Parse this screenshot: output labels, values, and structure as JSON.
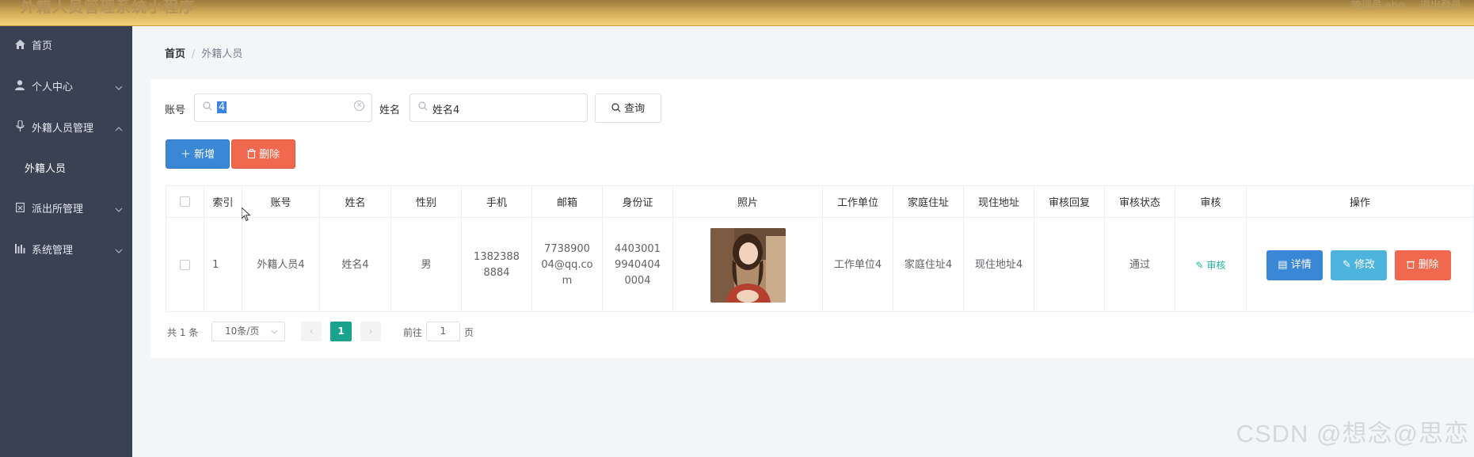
{
  "app": {
    "title": "外籍人员管理系统小程序",
    "admin_label": "管理员 abo",
    "logout_label": "退出登录"
  },
  "sidebar": {
    "items": [
      {
        "label": "首页",
        "icon": "home-icon",
        "has_children": false
      },
      {
        "label": "个人中心",
        "icon": "user-icon",
        "has_children": true
      },
      {
        "label": "外籍人员管理",
        "icon": "mic-icon",
        "has_children": true
      },
      {
        "label": "派出所管理",
        "icon": "clipboard-icon",
        "has_children": true
      },
      {
        "label": "系统管理",
        "icon": "chart-icon",
        "has_children": true
      }
    ],
    "active_sub_item": "外籍人员"
  },
  "breadcrumb": {
    "home": "首页",
    "separator": "/",
    "current": "外籍人员"
  },
  "search": {
    "account_label": "账号",
    "account_value": "4",
    "name_label": "姓名",
    "name_value": "姓名4",
    "query_button": "查询"
  },
  "actions": {
    "add": "新增",
    "delete": "删除"
  },
  "table": {
    "columns": [
      "索引",
      "账号",
      "姓名",
      "性别",
      "手机",
      "邮箱",
      "身份证",
      "照片",
      "工作单位",
      "家庭住址",
      "现住地址",
      "审核回复",
      "审核状态",
      "审核",
      "操作"
    ],
    "rows": [
      {
        "index": "1",
        "account": "外籍人员4",
        "name": "姓名4",
        "gender": "男",
        "phone": "13823888884",
        "email": "773890004@qq.com",
        "id_card": "440300199404040004",
        "work_unit": "工作单位4",
        "home_address": "家庭住址4",
        "current_address": "现住地址4",
        "audit_reply": "",
        "audit_status": "通过",
        "audit_action": "审核",
        "ops": {
          "detail": "详情",
          "edit": "修改",
          "delete": "删除"
        }
      }
    ]
  },
  "pagination": {
    "total_text": "共 1 条",
    "page_size": "10条/页",
    "current_page": "1",
    "goto_label": "前往",
    "goto_value": "1",
    "page_suffix": "页"
  },
  "watermark": "CSDN @想念@思恋",
  "colors": {
    "header": "#d7b15c",
    "sidebar": "#394152",
    "primary": "#3a87d6",
    "danger": "#f0684e",
    "info": "#4cb4dd",
    "success": "#1aa38c"
  }
}
